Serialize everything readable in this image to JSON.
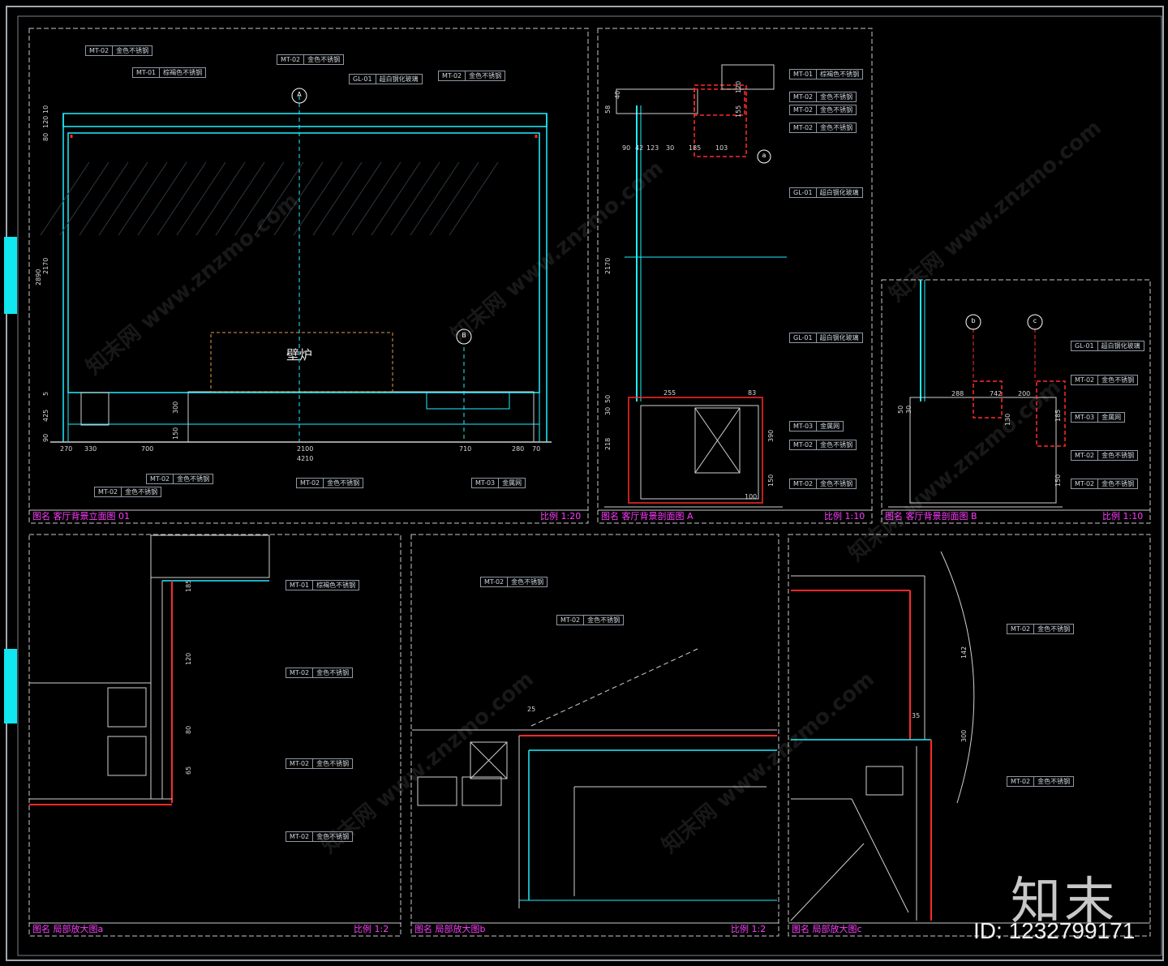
{
  "colors": {
    "cyan": "#1ef0ff",
    "red": "#ff2a2a",
    "white": "#e6e6e6",
    "grey": "#8f98a3",
    "magenta": "#ff3cff",
    "tab": "#11e7f0"
  },
  "panels": {
    "elevation_01": {
      "title": "图名 客厅背景立面图 01",
      "scale": "比例 1:20"
    },
    "section_a": {
      "title": "图名 客厅背景剖面图 A",
      "scale": "比例 1:10"
    },
    "section_b": {
      "title": "图名 客厅背景剖面图 B",
      "scale": "比例 1:10"
    },
    "detail_a": {
      "title": "图名 局部放大图a",
      "scale": "比例 1:2"
    },
    "detail_b": {
      "title": "图名 局部放大图b",
      "scale": "比例 1:2"
    },
    "detail_c": {
      "title": "图名 局部放大图c",
      "scale": ""
    }
  },
  "fireplace_label": "壁炉",
  "section_bubbles": {
    "a": "A",
    "b": "B",
    "b_lower": "b",
    "c": "c",
    "circle_a": "a"
  },
  "material_tags": [
    {
      "code": "MT-02",
      "name": "金色不锈钢"
    },
    {
      "code": "MT-01",
      "name": "棕褐色不锈钢"
    },
    {
      "code": "GL-01",
      "name": "超白钢化玻璃"
    },
    {
      "code": "MT-03",
      "name": "金属网"
    }
  ],
  "elevation_tags": {
    "t1": {
      "code": "MT-02",
      "name": "金色不锈钢"
    },
    "t2": {
      "code": "MT-01",
      "name": "棕褐色不锈钢"
    },
    "t3": {
      "code": "MT-02",
      "name": "金色不锈钢"
    },
    "t4": {
      "code": "GL-01",
      "name": "超白钢化玻璃"
    },
    "t5": {
      "code": "MT-02",
      "name": "金色不锈钢"
    },
    "t6": {
      "code": "MT-02",
      "name": "金色不锈钢"
    },
    "t7": {
      "code": "MT-02",
      "name": "金色不锈钢"
    },
    "t8": {
      "code": "MT-02",
      "name": "金色不锈钢"
    },
    "t9": {
      "code": "MT-03",
      "name": "金属网"
    }
  },
  "section_a_tags": {
    "t1": {
      "code": "MT-01",
      "name": "棕褐色不锈钢"
    },
    "t2": {
      "code": "MT-02",
      "name": "金色不锈钢"
    },
    "t3": {
      "code": "MT-02",
      "name": "金色不锈钢"
    },
    "t4": {
      "code": "MT-02",
      "name": "金色不锈钢"
    },
    "t5": {
      "code": "GL-01",
      "name": "超白钢化玻璃"
    },
    "t6": {
      "code": "GL-01",
      "name": "超白钢化玻璃"
    },
    "t7": {
      "code": "MT-03",
      "name": "金属网"
    },
    "t8": {
      "code": "MT-02",
      "name": "金色不锈钢"
    },
    "t9": {
      "code": "MT-02",
      "name": "金色不锈钢"
    }
  },
  "section_b_tags": {
    "t1": {
      "code": "GL-01",
      "name": "超白钢化玻璃"
    },
    "t2": {
      "code": "MT-02",
      "name": "金色不锈钢"
    },
    "t3": {
      "code": "MT-03",
      "name": "金属网"
    },
    "t4": {
      "code": "MT-02",
      "name": "金色不锈钢"
    },
    "t5": {
      "code": "MT-02",
      "name": "金色不锈钢"
    }
  },
  "detail_a_tags": {
    "t1": {
      "code": "MT-01",
      "name": "棕褐色不锈钢"
    },
    "t2": {
      "code": "MT-02",
      "name": "金色不锈钢"
    },
    "t3": {
      "code": "MT-02",
      "name": "金色不锈钢"
    },
    "t4": {
      "code": "MT-02",
      "name": "金色不锈钢"
    }
  },
  "detail_b_tags": {
    "t1": {
      "code": "MT-02",
      "name": "金色不锈钢"
    },
    "t2": {
      "code": "MT-02",
      "name": "金色不锈钢"
    }
  },
  "detail_c_tags": {
    "t1": {
      "code": "MT-02",
      "name": "金色不锈钢"
    },
    "t2": {
      "code": "MT-02",
      "name": "金色不锈钢"
    }
  },
  "elevation_dims": {
    "bottom": [
      "270",
      "330",
      "700",
      "2100",
      "710",
      "280",
      "70"
    ],
    "total": "4210",
    "left": [
      "10",
      "120",
      "80",
      "2170",
      "2890",
      "5",
      "425",
      "90"
    ],
    "fire": [
      "300",
      "150"
    ]
  },
  "section_a_dims": {
    "top": [
      "90",
      "42",
      "123",
      "30",
      "185",
      "103"
    ],
    "left": [
      "58",
      "40",
      "2170",
      "50",
      "30",
      "218"
    ],
    "bottom": [
      "255",
      "83",
      "390",
      "150",
      "100"
    ],
    "right": [
      "120",
      "155"
    ]
  },
  "section_b_dims": {
    "top": [
      "288",
      "742",
      "200"
    ],
    "left": [
      "50",
      "30"
    ],
    "mid": [
      "130",
      "185",
      "150"
    ]
  },
  "detail_a_dims": [
    "185",
    "120",
    "80",
    "65"
  ],
  "detail_b_dims": [
    "25"
  ],
  "detail_c_dims": [
    "142",
    "35",
    "300"
  ],
  "watermark": "知末网 www.znzmo.com",
  "logo": "知末",
  "id_text": "ID: 1232799171"
}
